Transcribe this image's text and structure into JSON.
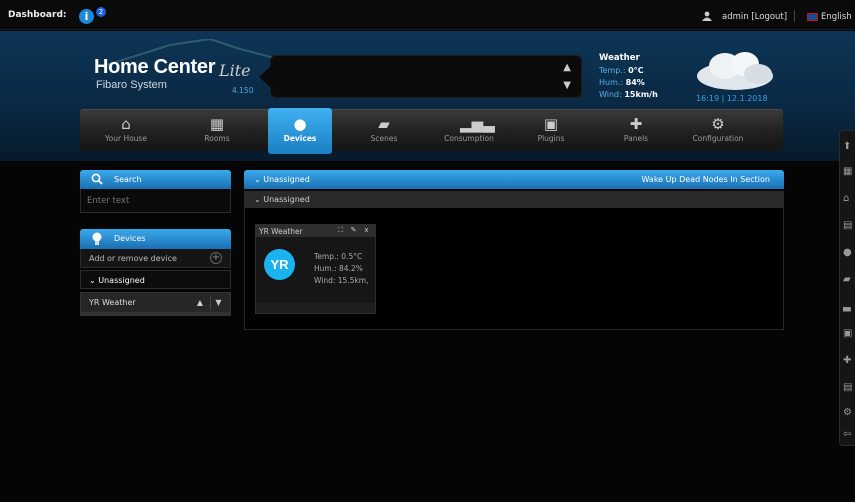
{
  "topbar": {
    "dashboard_label": "Dashboard:",
    "info_icon": "info-icon",
    "notification_count": "2",
    "user_text": "admin [Logout]",
    "language": "English"
  },
  "header": {
    "brand_title": "Home Center",
    "brand_lite": "Lite",
    "brand_subtitle": "Fibaro System",
    "version": "4.150",
    "weather": {
      "title": "Weather",
      "temp_label": "Temp.:",
      "temp_value": "0°C",
      "hum_label": "Hum.:",
      "hum_value": "84%",
      "wind_label": "Wind:",
      "wind_value": "15km/h"
    },
    "time": "16:19",
    "date": "12.1.2018"
  },
  "nav": {
    "items": [
      {
        "label": "Your House",
        "icon": "house-icon"
      },
      {
        "label": "Rooms",
        "icon": "rooms-icon"
      },
      {
        "label": "Devices",
        "icon": "bulb-icon"
      },
      {
        "label": "Scenes",
        "icon": "clapper-icon"
      },
      {
        "label": "Consumption",
        "icon": "bar-chart-icon"
      },
      {
        "label": "Plugins",
        "icon": "plugin-box-icon"
      },
      {
        "label": "Panels",
        "icon": "panels-icon"
      },
      {
        "label": "Configuration",
        "icon": "gears-icon"
      }
    ],
    "active": "Devices"
  },
  "sidebar": {
    "search_title": "Search",
    "search_placeholder": "Enter text",
    "devices_title": "Devices",
    "add_remove": "Add or remove device",
    "unassigned": "Unassigned",
    "device_item": "YR Weather"
  },
  "main": {
    "section": "Unassigned",
    "wake_up": "Wake Up Dead Nodes In Section",
    "room": "Unassigned",
    "card": {
      "name": "YR Weather",
      "logo_text": "YR",
      "temp": "Temp.: 0.5°C",
      "hum": "Hum.: 84.2%",
      "wind": "Wind: 15.5km,"
    }
  },
  "colors": {
    "accent_blue": "#2a94d9",
    "background": "#050505"
  }
}
